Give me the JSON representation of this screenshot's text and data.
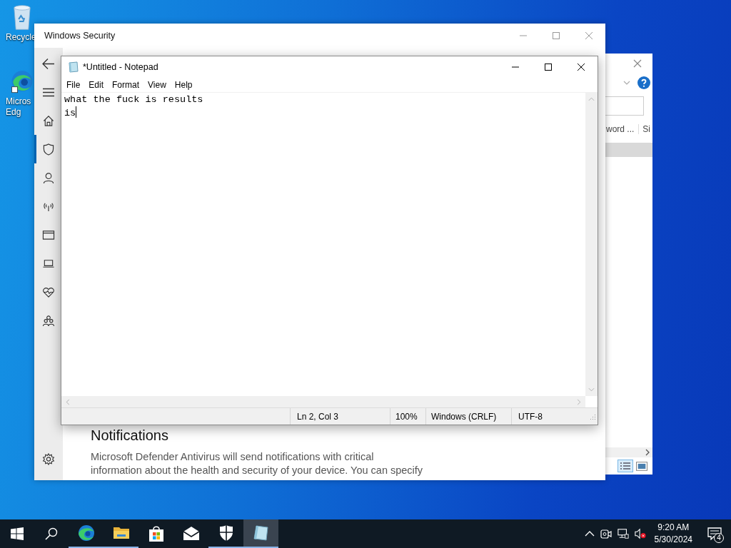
{
  "desktop_icons": [
    {
      "kind": "recycle",
      "label": "Recycle"
    },
    {
      "kind": "edge",
      "label": "Micros\nEdg"
    }
  ],
  "back_window": {
    "column_headers": [
      "word ...",
      "Si"
    ]
  },
  "security_window": {
    "title": "Windows Security",
    "nav_items": [
      {
        "kind": "home",
        "selected": false
      },
      {
        "kind": "shield",
        "selected": true
      },
      {
        "kind": "person",
        "selected": false
      },
      {
        "kind": "wireless",
        "selected": false
      },
      {
        "kind": "window",
        "selected": false
      },
      {
        "kind": "laptop",
        "selected": false
      },
      {
        "kind": "heart",
        "selected": false
      },
      {
        "kind": "family",
        "selected": false
      }
    ],
    "heading": "Notifications",
    "paragraph": "Microsoft Defender Antivirus will send notifications with critical\ninformation about the health and security of your device. You can specify"
  },
  "notepad": {
    "title": "*Untitled - Notepad",
    "menu": [
      "File",
      "Edit",
      "Format",
      "View",
      "Help"
    ],
    "text": "what the fuck is results\nis",
    "status": [
      "Ln 2, Col 3",
      "100%",
      "Windows (CRLF)",
      "UTF-8"
    ]
  },
  "taskbar": {
    "apps": [
      {
        "kind": "edge",
        "running": true,
        "active": false
      },
      {
        "kind": "explorer",
        "running": true,
        "active": false
      },
      {
        "kind": "store",
        "running": false,
        "active": false
      },
      {
        "kind": "mail",
        "running": false,
        "active": false
      },
      {
        "kind": "security",
        "running": true,
        "active": false
      },
      {
        "kind": "notepad",
        "running": true,
        "active": true
      }
    ],
    "volume_muted": true,
    "time": "9:20 AM",
    "date": "5/30/2024",
    "notification_count": "4"
  }
}
